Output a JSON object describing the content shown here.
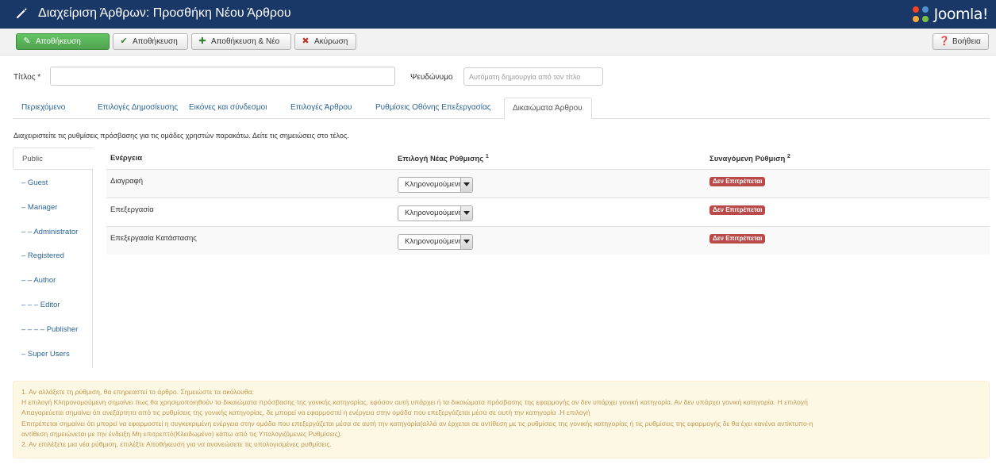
{
  "header": {
    "title": "Διαχείριση Άρθρων: Προσθήκη Νέου Άρθρου",
    "logo_text": "Joomla!"
  },
  "toolbar": {
    "save": "Αποθήκευση",
    "save_close": "Αποθήκευση",
    "save_new": "Αποθήκευση & Νέο",
    "cancel": "Ακύρωση",
    "help": "Βοήθεια"
  },
  "form": {
    "title_label": "Τίτλος *",
    "title_value": "",
    "alias_label": "Ψευδώνυμο",
    "alias_placeholder": "Αυτόματη δημιουργία από τον τίτλο"
  },
  "tabs": [
    {
      "label": "Περιεχόμενο"
    },
    {
      "label": "Επιλογές Δημοσίευσης"
    },
    {
      "label": "Εικόνες και σύνδεσμοι"
    },
    {
      "label": "Επιλογές Άρθρου"
    },
    {
      "label": "Ρυθμίσεις Οθόνης Επεξεργασίας"
    },
    {
      "label": "Δικαιώματα Άρθρου"
    }
  ],
  "description": "Διαχειριστείτε τις ρυθμίσεις πρόσβασης για τις ομάδες χρηστών παρακάτω. Δείτε τις σημειώσεις στο τέλος.",
  "groups": [
    {
      "label": "Public"
    },
    {
      "label": "– Guest"
    },
    {
      "label": "– Manager"
    },
    {
      "label": "– – Administrator"
    },
    {
      "label": "– Registered"
    },
    {
      "label": "– – Author"
    },
    {
      "label": "– – – Editor"
    },
    {
      "label": "– – – – Publisher"
    },
    {
      "label": "– Super Users"
    }
  ],
  "permissions": {
    "col_action": "Ενέργεια",
    "col_new": "Επιλογή Νέας Ρύθμισης",
    "col_new_sup": "1",
    "col_calc": "Συναγόμενη Ρύθμιση",
    "col_calc_sup": "2",
    "rows": [
      {
        "action": "Διαγραφή",
        "setting": "Κληρονομούμενη",
        "calculated": "Δεν Επιτρέπεται"
      },
      {
        "action": "Επεξεργασία",
        "setting": "Κληρονομούμενη",
        "calculated": "Δεν Επιτρέπεται"
      },
      {
        "action": "Επεξεργασία Κατάστασης",
        "setting": "Κληρονομούμενη",
        "calculated": "Δεν Επιτρέπεται"
      }
    ]
  },
  "notes": {
    "line1": "1. Αν αλλάξετε τη ρύθμιση, θα επηρεαστεί το άρθρο. Σημειώστε τα ακόλουθα:",
    "line2": "Η επιλογή Κληρονομούμενη σημαίνει πως θα χρησιμοποιηθούν τα δικαιώματα πρόσβασης της γονικής κατηγορίας, εφόσον αυτή υπάρχει ή τα δικαιώματα πρόσβασης της εφαρμογής αν δεν υπάρχει γονική κατηγορία. Αν δεν υπάρχει γονική κατηγορία. Η επιλογή",
    "line3": "Απαγορεύεται σημαίνει ότι ανεξάρτητα από τις ρυθμίσεις της γονικής κατηγορίας, δε μπορεί να εφαρμοστεί η ενέργεια στην ομάδα που επεξεργάζεται μέσα σε αυτή την κατηγορία .Η επιλογή",
    "line4": "Επιτρέπεται σημαίνει ότι μπορεί να εφαρμοστεί η συγκεκριμένη ενέργεια στην ομάδα που επεξεργάζεται μέσα σε αυτή την κατηγορία(αλλά αν έρχεται σε αντίθεση με τις ρυθμίσεις της γονικής κατηγορίας ή τις ρυθμίσεις της εφαρμογής δε θα έχει κανένα αντίκτυπο-η",
    "line5": "αντίθεση σημειώνεται με την ένδειξη Μη επιτρεπτό(Κλειδωμένο) κάπω από τις Υπολογιζόμενες Ρυθμίσεις).",
    "line6": "2. Αν επιλέξετε μια νέα ρύθμιση, επιλέξτε Αποθήκευση για να ανανεώσετε τις υπολογισμένες ρυθμίσεις."
  }
}
